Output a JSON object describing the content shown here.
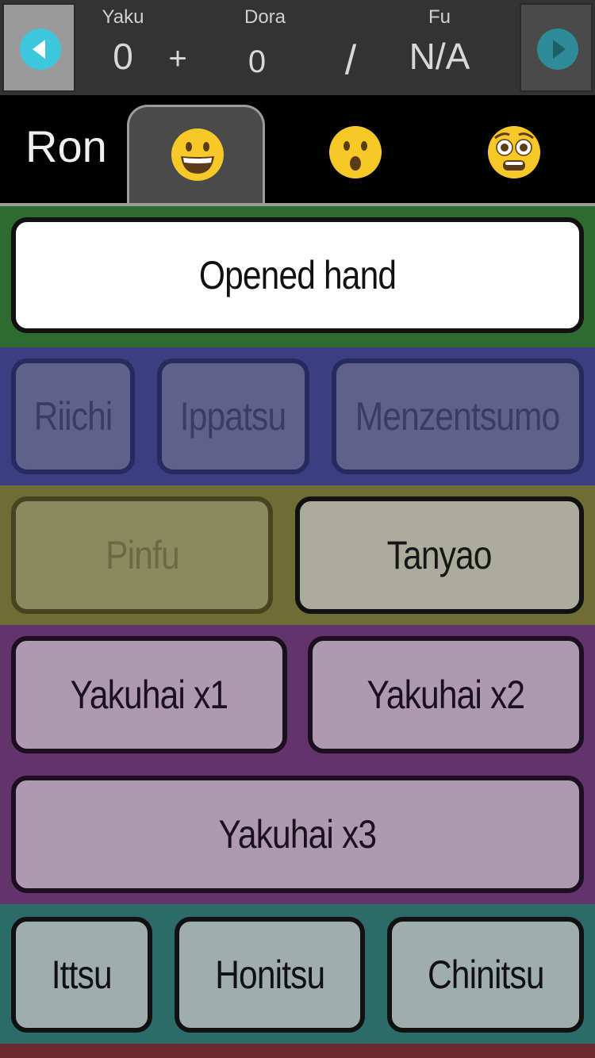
{
  "header": {
    "yaku_label": "Yaku",
    "yaku_value": "0",
    "plus_symbol": "+",
    "dora_label": "Dora",
    "dora_value": "0",
    "slash_symbol": "/",
    "fu_label": "Fu",
    "fu_value": "N/A",
    "prev_icon": "arrow-left-icon",
    "next_icon": "arrow-right-icon"
  },
  "tabs": {
    "win_type_label": "Ron",
    "items": [
      {
        "icon": "grinning-face-emoji",
        "active": true
      },
      {
        "icon": "surprised-face-emoji",
        "active": false
      },
      {
        "icon": "flushed-face-emoji",
        "active": false
      }
    ]
  },
  "hand_state": {
    "label": "Opened hand"
  },
  "groups": {
    "closed_only": {
      "color": "#3b3f81",
      "items": [
        {
          "label": "Riichi",
          "enabled": false
        },
        {
          "label": "Ippatsu",
          "enabled": false
        },
        {
          "label": "Menzentsumo",
          "enabled": false
        }
      ]
    },
    "simple": {
      "color": "#6e6d34",
      "items": [
        {
          "label": "Pinfu",
          "enabled": false
        },
        {
          "label": "Tanyao",
          "enabled": true
        }
      ]
    },
    "yakuhai": {
      "color": "#62346b",
      "items": [
        {
          "label": "Yakuhai x1",
          "enabled": true
        },
        {
          "label": "Yakuhai x2",
          "enabled": true
        },
        {
          "label": "Yakuhai x3",
          "enabled": true
        }
      ]
    },
    "suits": {
      "color": "#2c6b6a",
      "items": [
        {
          "label": "Ittsu",
          "enabled": true
        },
        {
          "label": "Honitsu",
          "enabled": true
        },
        {
          "label": "Chinitsu",
          "enabled": true
        }
      ]
    }
  },
  "colors": {
    "accent_cyan": "#3cc7dc",
    "header_bg": "#333333",
    "green_section": "#2d6b31"
  }
}
